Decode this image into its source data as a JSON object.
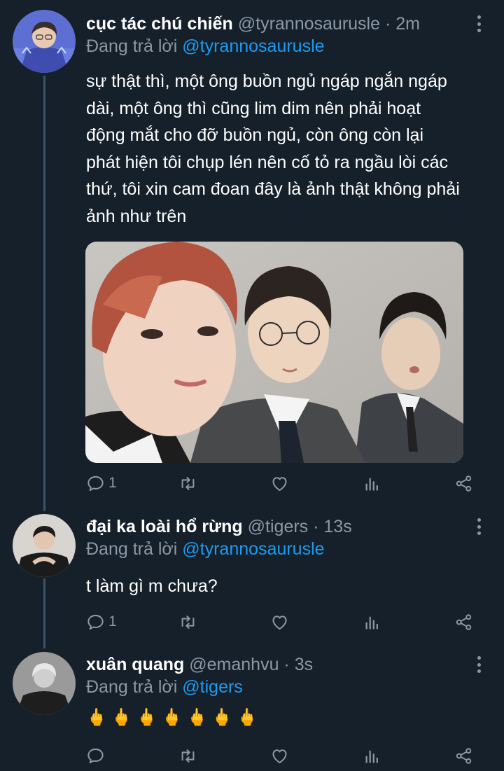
{
  "tweets": [
    {
      "name": "cục tác chú chiến",
      "handle": "@tyrannosaurusle",
      "dot": " · ",
      "time": "2m",
      "reply_label": "Đang trả lời ",
      "reply_mention": "@tyrannosaurusle",
      "text_lines": [
        "sự thật thì, một ông buồn ngủ ngáp ngắn ngáp",
        "dài, một ông thì cũng lim dim nên phải hoạt",
        "động mắt cho đỡ buồn ngủ, còn ông còn lại",
        "phát hiện tôi chụp lén nên cố tỏ ra ngầu lòi các",
        "thứ, tôi xin cam đoan đây là ảnh thật không phải",
        "ảnh như trên"
      ],
      "reply_count": "1"
    },
    {
      "name": "đại ka loài hổ rừng",
      "handle": "@tigers",
      "dot": " · ",
      "time": "13s",
      "reply_label": "Đang trả lời ",
      "reply_mention": "@tyrannosaurusle",
      "text_lines": [
        "t làm gì m chưa?"
      ],
      "reply_count": "1"
    },
    {
      "name": "xuân quang",
      "handle": "@emanhvu",
      "dot": " · ",
      "time": "3s",
      "reply_label": "Đang trả lời ",
      "reply_mention": "@tigers",
      "emoji_text": "🖕🖕🖕🖕🖕🖕🖕",
      "reply_count": ""
    }
  ],
  "icons": {
    "reply": "reply-icon",
    "retweet": "retweet-icon",
    "like": "like-icon",
    "views": "views-icon",
    "share": "share-icon",
    "more": "more-options-icon"
  },
  "colors": {
    "background": "#15202b",
    "secondary_text": "#8b98a5",
    "link": "#1d9bf0",
    "thread_line": "#3d5466"
  }
}
